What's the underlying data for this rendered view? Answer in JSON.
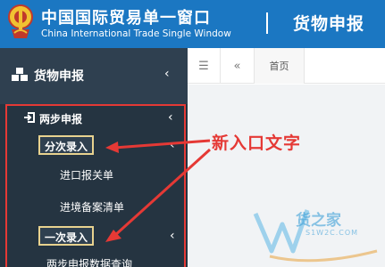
{
  "header": {
    "title_cn": "中国国际贸易单一窗口",
    "title_en": "China International Trade Single Window",
    "module_title": "货物申报",
    "logo_icon": "customs-emblem-icon"
  },
  "sidebar": {
    "main_item": {
      "label": "货物申报",
      "icon": "cubes-icon"
    },
    "section": {
      "label": "两步申报",
      "icon": "sign-in-icon"
    },
    "items": [
      {
        "label": "分次录入",
        "boxed": true
      },
      {
        "label": "进口报关单"
      },
      {
        "label": "进境备案清单"
      },
      {
        "label": "一次录入",
        "boxed": true
      },
      {
        "label": "两步申报数据查询"
      }
    ]
  },
  "tabbar": {
    "menu_icon": "hamburger-icon",
    "back_icon": "double-left-icon",
    "home_tab": "首页"
  },
  "annotation": {
    "text": "新入口文字"
  },
  "watermark": {
    "text": "货之家",
    "url": "S1W2C.COM"
  },
  "colors": {
    "header_bg": "#1b77c2",
    "sidebar_bg": "#2f4050",
    "annotation_red": "#e53935",
    "highlight_box": "#e8d28f"
  }
}
